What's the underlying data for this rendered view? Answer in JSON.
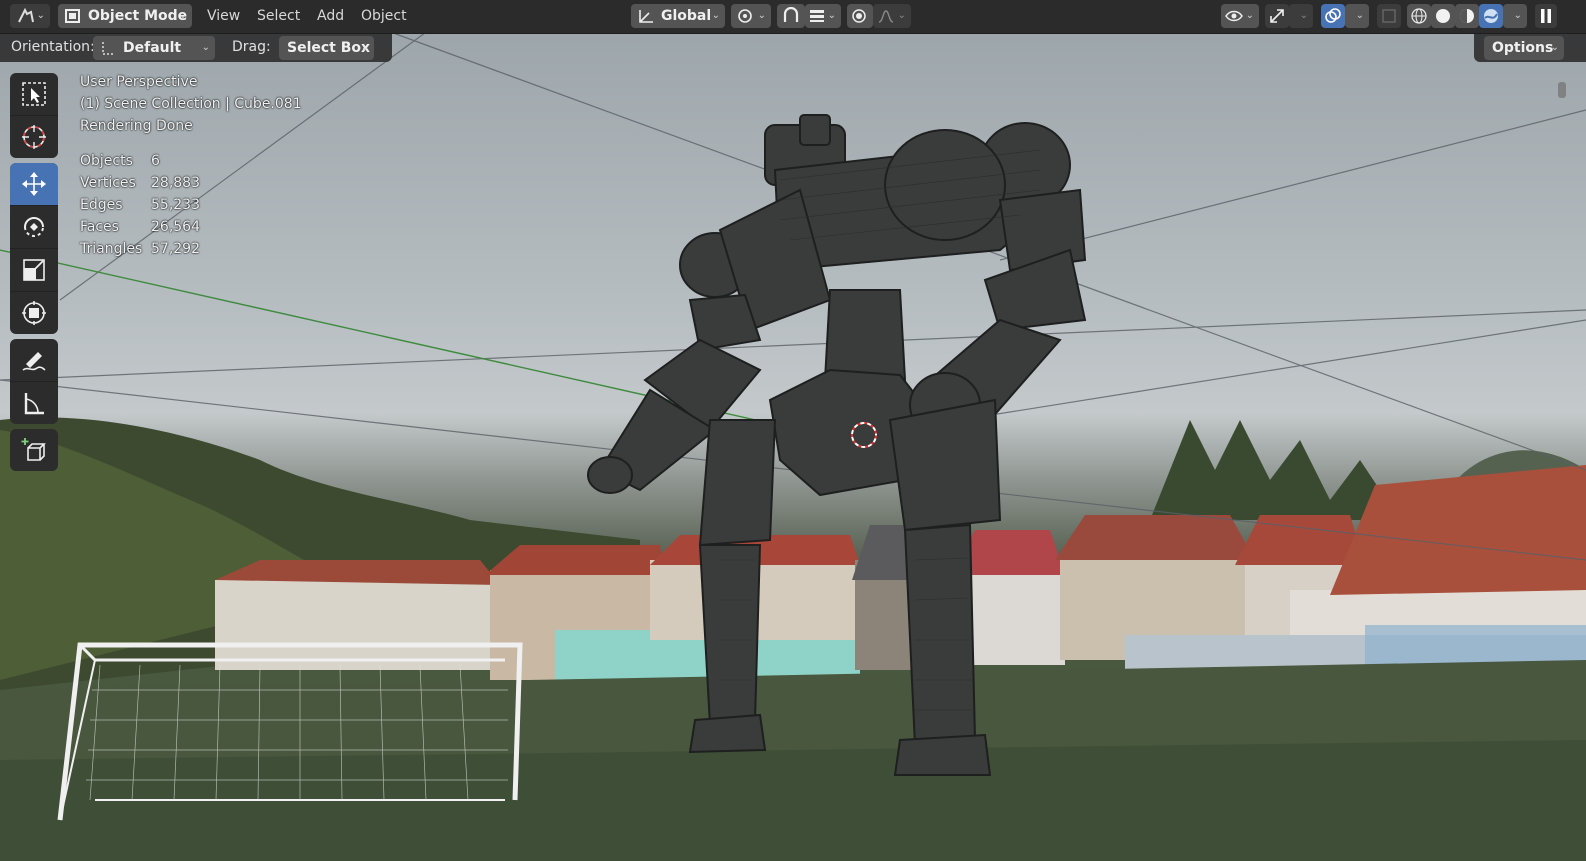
{
  "header": {
    "mode_selector": "Object Mode",
    "menus": [
      "View",
      "Select",
      "Add",
      "Object"
    ],
    "transform_orientation": "Global"
  },
  "tool_header": {
    "orientation_label": "Orientation:",
    "orientation_value": "Default",
    "drag_label": "Drag:",
    "drag_value": "Select Box",
    "options_label": "Options"
  },
  "overlay": {
    "view_name": "User Perspective",
    "collection_path": "(1) Scene Collection | Cube.081",
    "render_status": "Rendering Done",
    "stats": [
      {
        "label": "Objects",
        "value": "6"
      },
      {
        "label": "Vertices",
        "value": "28,883"
      },
      {
        "label": "Edges",
        "value": "55,233"
      },
      {
        "label": "Faces",
        "value": "26,564"
      },
      {
        "label": "Triangles",
        "value": "57,292"
      }
    ]
  },
  "toolbar": {
    "tools": [
      "select-box-icon",
      "cursor-icon",
      "move-icon",
      "rotate-icon",
      "scale-icon",
      "transform-icon",
      "annotate-icon",
      "measure-icon",
      "add-cube-icon"
    ],
    "active_tool": "move-icon"
  },
  "colors": {
    "active_blue": "#4772b3",
    "header_bg": "#2b2b2b",
    "button_bg": "#545454"
  }
}
